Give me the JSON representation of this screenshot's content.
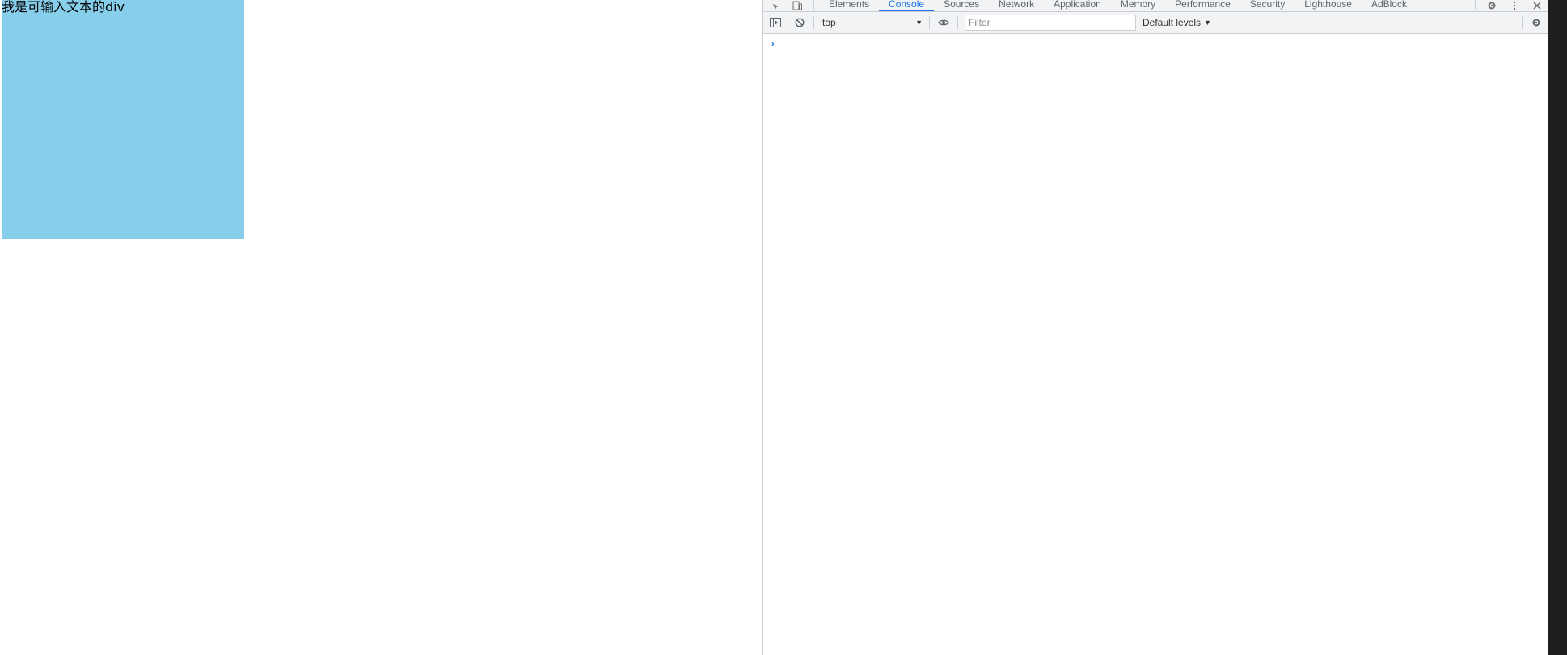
{
  "page": {
    "editable_div_text": "我是可输入文本的div",
    "editable_div_color": "#87ceeb"
  },
  "devtools": {
    "tabs": [
      {
        "label": "Elements",
        "active": false
      },
      {
        "label": "Console",
        "active": true
      },
      {
        "label": "Sources",
        "active": false
      },
      {
        "label": "Network",
        "active": false
      },
      {
        "label": "Application",
        "active": false
      },
      {
        "label": "Memory",
        "active": false
      },
      {
        "label": "Performance",
        "active": false
      },
      {
        "label": "Security",
        "active": false
      },
      {
        "label": "Lighthouse",
        "active": false
      },
      {
        "label": "AdBlock",
        "active": false
      }
    ],
    "toolbar": {
      "context": "top",
      "filter_placeholder": "Filter",
      "levels": "Default levels"
    },
    "accent_color": "#1a73e8",
    "icons": [
      "inspect-icon",
      "device-toggle-icon",
      "settings-icon",
      "more-options-icon",
      "close-icon",
      "sidebar-toggle-icon",
      "clear-console-icon",
      "eye-icon",
      "console-settings-icon",
      "prompt-chevron-icon"
    ]
  }
}
